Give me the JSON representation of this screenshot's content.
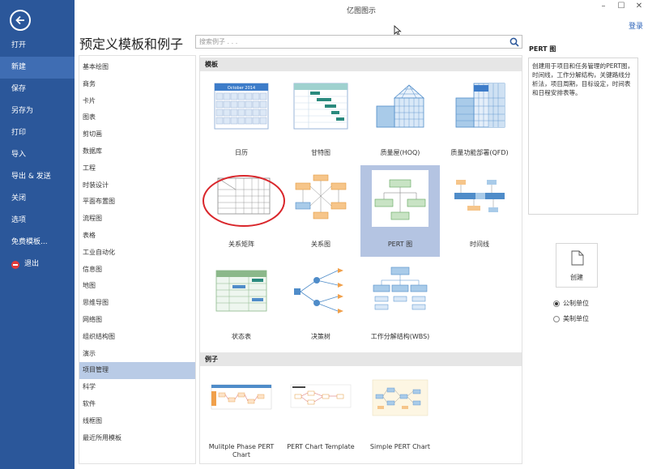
{
  "app": {
    "title": "亿图图示",
    "login": "登录"
  },
  "sidebar": {
    "items": [
      {
        "label": "打开",
        "active": false
      },
      {
        "label": "新建",
        "active": true
      },
      {
        "label": "保存",
        "active": false
      },
      {
        "label": "另存为",
        "active": false
      },
      {
        "label": "打印",
        "active": false
      },
      {
        "label": "导入",
        "active": false
      },
      {
        "label": "导出 & 发送",
        "active": false
      },
      {
        "label": "关闭",
        "active": false
      },
      {
        "label": "选项",
        "active": false
      },
      {
        "label": "免费模板...",
        "active": false
      },
      {
        "label": "退出",
        "active": false
      }
    ]
  },
  "heading": "预定义模板和例子",
  "search": {
    "placeholder": "搜索例子 . . ."
  },
  "categories": [
    "基本绘图",
    "商务",
    "卡片",
    "图表",
    "剪切画",
    "数据库",
    "工程",
    "时装设计",
    "平面布置图",
    "流程图",
    "表格",
    "工业自动化",
    "信息图",
    "地图",
    "思维导图",
    "网络图",
    "组织结构图",
    "演示",
    "项目管理",
    "科学",
    "软件",
    "线框图",
    "最近所用模板"
  ],
  "active_category": "项目管理",
  "gallery": {
    "templates_header": "模板",
    "examples_header": "例子",
    "templates": [
      "日历",
      "甘特图",
      "质量屋(HOQ)",
      "质量功能部署(QFD)",
      "关系矩阵",
      "关系图",
      "PERT 图",
      "时间线",
      "状态表",
      "决策树",
      "工作分解结构(WBS)"
    ],
    "selected_template": "PERT 图",
    "examples": [
      "Mulitple Phase PERT Chart",
      "PERT Chart Template",
      "Simple PERT Chart"
    ],
    "calendar_month": "October 2014"
  },
  "details": {
    "title": "PERT 图",
    "description": "创建用于项目和任务管理的PERT图，时间线，工作分解结构，关键路线分析法，项目周期，目标设定，时间表和日程安排表等。",
    "create_label": "创建",
    "units": [
      {
        "label": "公制单位",
        "checked": true
      },
      {
        "label": "美制单位",
        "checked": false
      }
    ]
  },
  "colors": {
    "sidebar": "#2b579a",
    "selected": "#b4c4e2",
    "accent": "#2b62b8",
    "highlight_ring": "#d9262b"
  }
}
